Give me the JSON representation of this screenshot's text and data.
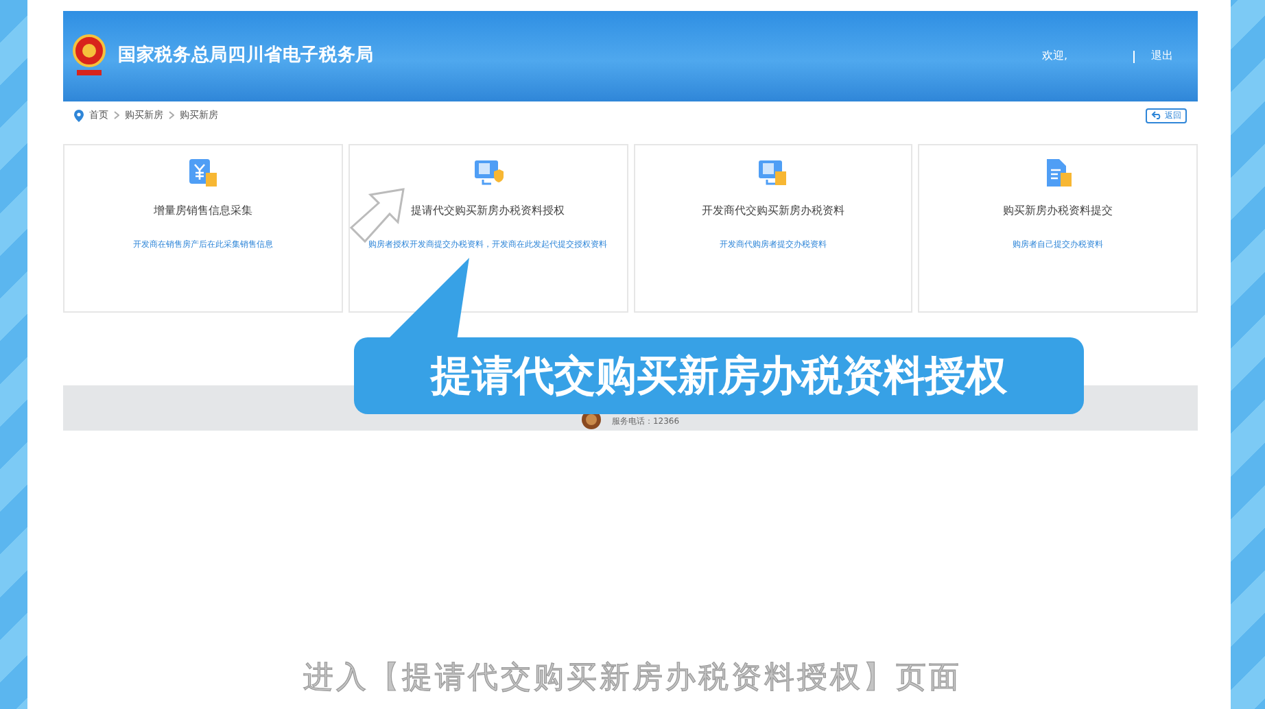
{
  "header": {
    "title": "国家税务总局四川省电子税务局",
    "welcome": "欢迎,",
    "logout": "退出"
  },
  "breadcrumb": [
    "首页",
    "购买新房",
    "购买新房"
  ],
  "back_button": "返回",
  "cards": [
    {
      "kind": "money",
      "title": "增量房销售信息采集",
      "description": "开发商在销售房产后在此采集销售信息"
    },
    {
      "kind": "monitor-shield",
      "title": "提请代交购买新房办税资料授权",
      "description": "购房者授权开发商提交办税资料，开发商在此发起代提交授权资料"
    },
    {
      "kind": "monitor-doc",
      "title": "开发商代交购买新房办税资料",
      "description": "开发商代购房者提交办税资料"
    },
    {
      "kind": "document",
      "title": "购买新房办税资料提交",
      "description": "购房者自己提交办税资料"
    }
  ],
  "footer": {
    "phone": "服务电话：12366"
  },
  "callout": "提请代交购买新房办税资料授权",
  "caption": "进入【提请代交购买新房办税资料授权】页面"
}
